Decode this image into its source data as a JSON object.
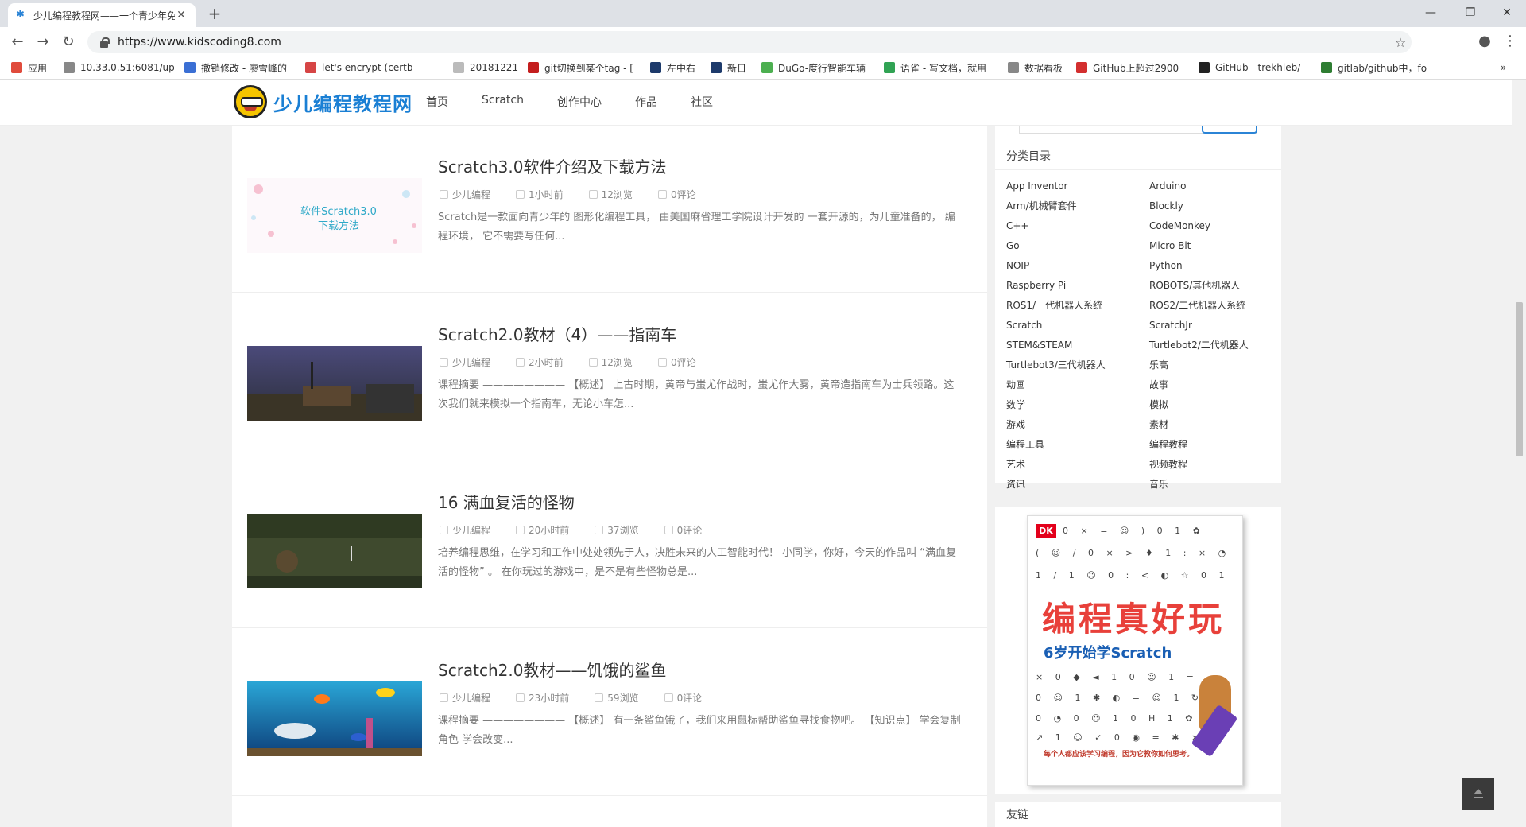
{
  "browser": {
    "tab_title": "少儿编程教程网——一个青少年免费",
    "url": "https://www.kidscoding8.com",
    "bookmarks": [
      {
        "label": "应用",
        "color": "#e04b3c"
      },
      {
        "label": "10.33.0.51:6081/up",
        "color": "#888888"
      },
      {
        "label": "撤销修改 - 廖雪峰的",
        "color": "#3b6fd4"
      },
      {
        "label": "let's encrypt (certb",
        "color": "#d64545"
      },
      {
        "label": "20181221",
        "color": "#bbbbbb"
      },
      {
        "label": "git切换到某个tag - [",
        "color": "#c41e1e"
      },
      {
        "label": "左中右",
        "color": "#1d3a6b"
      },
      {
        "label": "新日",
        "color": "#1d3a6b"
      },
      {
        "label": "DuGo-度行智能车辆",
        "color": "#4caf50"
      },
      {
        "label": "语雀 - 写文档，就用",
        "color": "#31a354"
      },
      {
        "label": "数据看板",
        "color": "#888888"
      },
      {
        "label": "GitHub上超过2900",
        "color": "#d32f2f"
      },
      {
        "label": "GitHub - trekhleb/",
        "color": "#222222"
      },
      {
        "label": "gitlab/github中，fo",
        "color": "#2e7d32"
      }
    ]
  },
  "site": {
    "logo_text": "少儿编程教程网",
    "nav": [
      "首页",
      "Scratch",
      "创作中心",
      "作品",
      "社区"
    ]
  },
  "posts": [
    {
      "title": "Scratch3.0软件介绍及下载方法",
      "author": "少儿编程",
      "time": "1小时前",
      "views": "12浏览",
      "comments": "0评论",
      "excerpt": "Scratch是一款面向青少年的 图形化编程工具， 由美国麻省理工学院设计开发的 一套开源的，为儿童准备的， 编程环境， 它不需要写任何...",
      "thumb_text": "软件Scratch3.0\n下载方法"
    },
    {
      "title": "Scratch2.0教材（4）——指南车",
      "author": "少儿编程",
      "time": "2小时前",
      "views": "12浏览",
      "comments": "0评论",
      "excerpt": "课程摘要 ———————— 【概述】 上古时期，黄帝与蚩尤作战时，蚩尤作大雾，黄帝造指南车为士兵领路。这次我们就来模拟一个指南车，无论小车怎..."
    },
    {
      "title": "16 满血复活的怪物",
      "author": "少儿编程",
      "time": "20小时前",
      "views": "37浏览",
      "comments": "0评论",
      "excerpt": "培养编程思维，在学习和工作中处处领先于人，决胜未来的人工智能时代！ 小同学，你好，今天的作品叫 “满血复活的怪物” 。 在你玩过的游戏中，是不是有些怪物总是..."
    },
    {
      "title": "Scratch2.0教材——饥饿的鲨鱼",
      "author": "少儿编程",
      "time": "23小时前",
      "views": "59浏览",
      "comments": "0评论",
      "excerpt": "课程摘要 ———————— 【概述】 有一条鲨鱼饿了，我们来用鼠标帮助鲨鱼寻找食物吧。 【知识点】 学会复制角色 学会改变..."
    }
  ],
  "sidebar": {
    "categories_title": "分类目录",
    "categories": [
      "App Inventor",
      "Arduino",
      "Arm/机械臂套件",
      "Blockly",
      "C++",
      "CodeMonkey",
      "Go",
      "Micro Bit",
      "NOIP",
      "Python",
      "Raspberry Pi",
      "ROBOTS/其他机器人",
      "ROS1/一代机器人系统",
      "ROS2/二代机器人系统",
      "Scratch",
      "ScratchJr",
      "STEM&STEAM",
      "Turtlebot2/二代机器人",
      "Turtlebot3/三代机器人",
      "乐高",
      "动画",
      "故事",
      "数学",
      "模拟",
      "游戏",
      "素材",
      "编程工具",
      "编程教程",
      "艺术",
      "视频教程",
      "资讯",
      "音乐"
    ],
    "book": {
      "brand": "DK",
      "title": "编程真好玩",
      "subtitle": "6岁开始学Scratch",
      "tagline": "每个人都应该学习编程，因为它教你如何思考。"
    },
    "friends_title": "友链"
  }
}
